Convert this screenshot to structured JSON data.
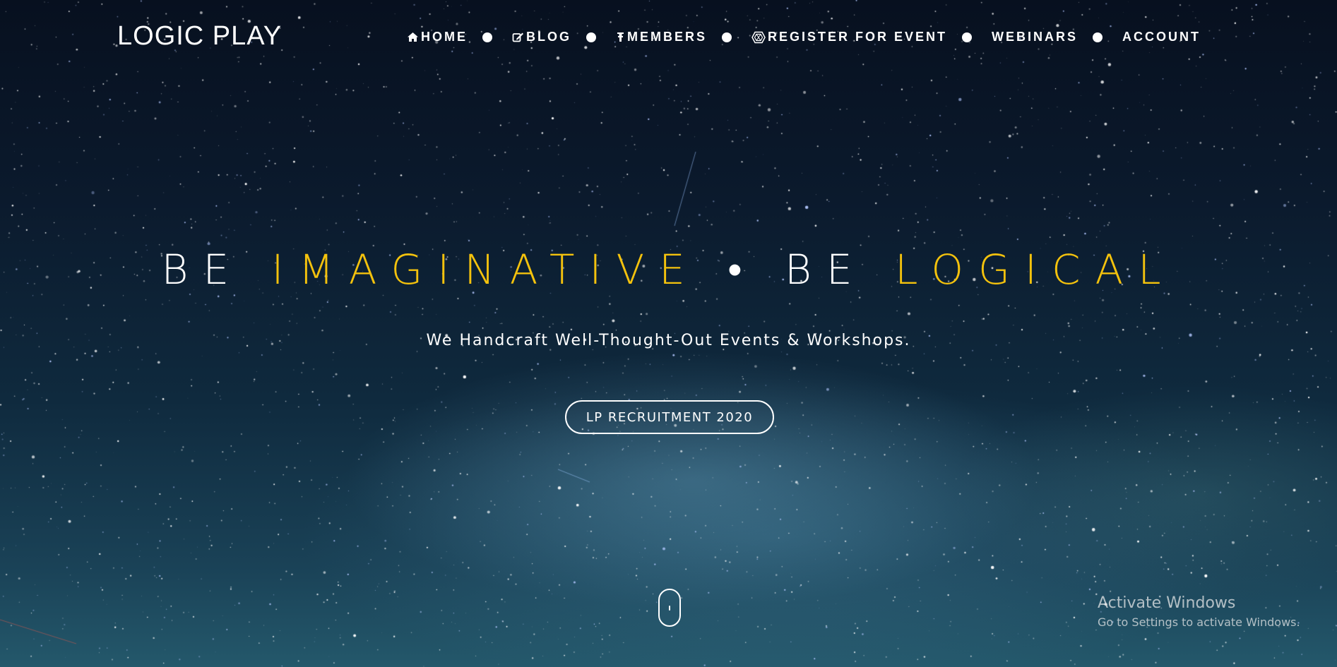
{
  "brand": {
    "name": "LOGIC PLAY"
  },
  "nav": {
    "items": [
      {
        "label": "HOME",
        "icon": "home-icon"
      },
      {
        "label": "BLOG",
        "icon": "edit-icon"
      },
      {
        "label": "MEMBERS",
        "icon": "user-icon"
      },
      {
        "label": "REGISTER FOR EVENT",
        "icon": "hexagon-icon"
      },
      {
        "label": "WEBINARS",
        "icon": ""
      },
      {
        "label": "ACCOUNT",
        "icon": ""
      }
    ]
  },
  "hero": {
    "title_part1": "BE ",
    "title_accent1": "IMAGINATIVE",
    "title_sep": " • BE ",
    "title_accent2": "LOGICAL",
    "subtitle": "We Handcraft Well-Thought-Out Events & Workshops.",
    "cta_label": "LP RECRUITMENT 2020"
  },
  "windows_watermark": {
    "title": "Activate Windows",
    "subtitle": "Go to Settings to activate Windows."
  },
  "colors": {
    "accent": "#f4c20d",
    "text": "#ffffff",
    "sky_dark": "#07101f",
    "sky_light": "#24586b"
  }
}
